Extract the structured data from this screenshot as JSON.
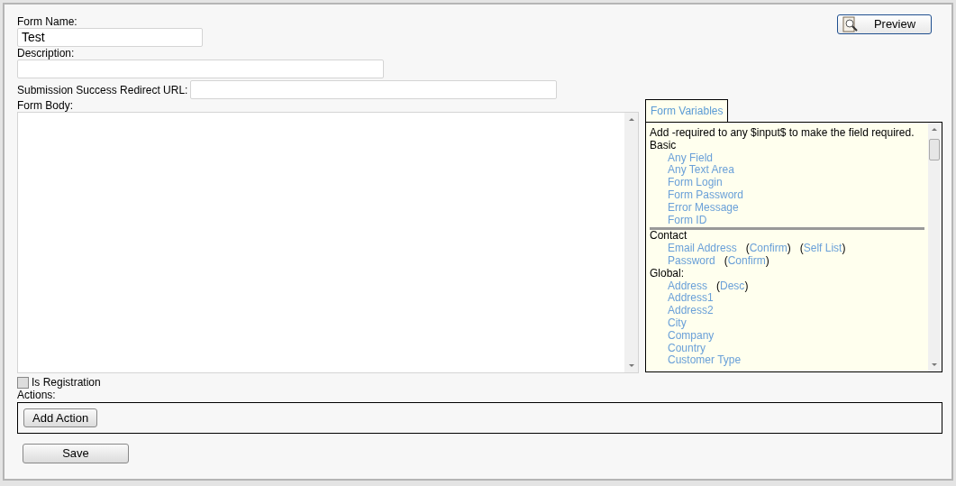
{
  "form_name": {
    "label": "Form Name:",
    "value": "Test"
  },
  "description": {
    "label": "Description:"
  },
  "redirect_url": {
    "label": "Submission Success Redirect URL:"
  },
  "preview_button": "Preview",
  "form_body": {
    "label": "Form Body:"
  },
  "variables": {
    "tab": "Form Variables",
    "hint": "Add -required to any $input$ to make the field required.",
    "groups": [
      {
        "heading": "Basic",
        "divider": true,
        "items": [
          {
            "label": "Any Field"
          },
          {
            "label": "Any Text Area"
          },
          {
            "label": "Form Login"
          },
          {
            "label": "Form Password"
          },
          {
            "label": "Error Message"
          },
          {
            "label": "Form ID"
          }
        ]
      },
      {
        "heading": "Contact",
        "divider": false,
        "items": [
          {
            "label": "Email Address",
            "extras": [
              {
                "open": "(",
                "label": "Confirm",
                "close": ")"
              },
              {
                "open": "(",
                "label": "Self List",
                "close": ")"
              }
            ]
          },
          {
            "label": "Password",
            "extras": [
              {
                "open": "(",
                "label": "Confirm",
                "close": ")"
              }
            ]
          }
        ]
      },
      {
        "heading": "Global:",
        "divider": false,
        "items": [
          {
            "label": "Address",
            "extras": [
              {
                "open": "(",
                "label": "Desc",
                "close": ")"
              }
            ]
          },
          {
            "label": "Address1"
          },
          {
            "label": "Address2"
          },
          {
            "label": "City"
          },
          {
            "label": "Company"
          },
          {
            "label": "Country"
          },
          {
            "label": "Customer Type"
          }
        ]
      }
    ]
  },
  "is_registration": {
    "label": "Is Registration",
    "checked": false
  },
  "actions": {
    "label": "Actions:",
    "button": "Add Action"
  },
  "save_button": "Save"
}
